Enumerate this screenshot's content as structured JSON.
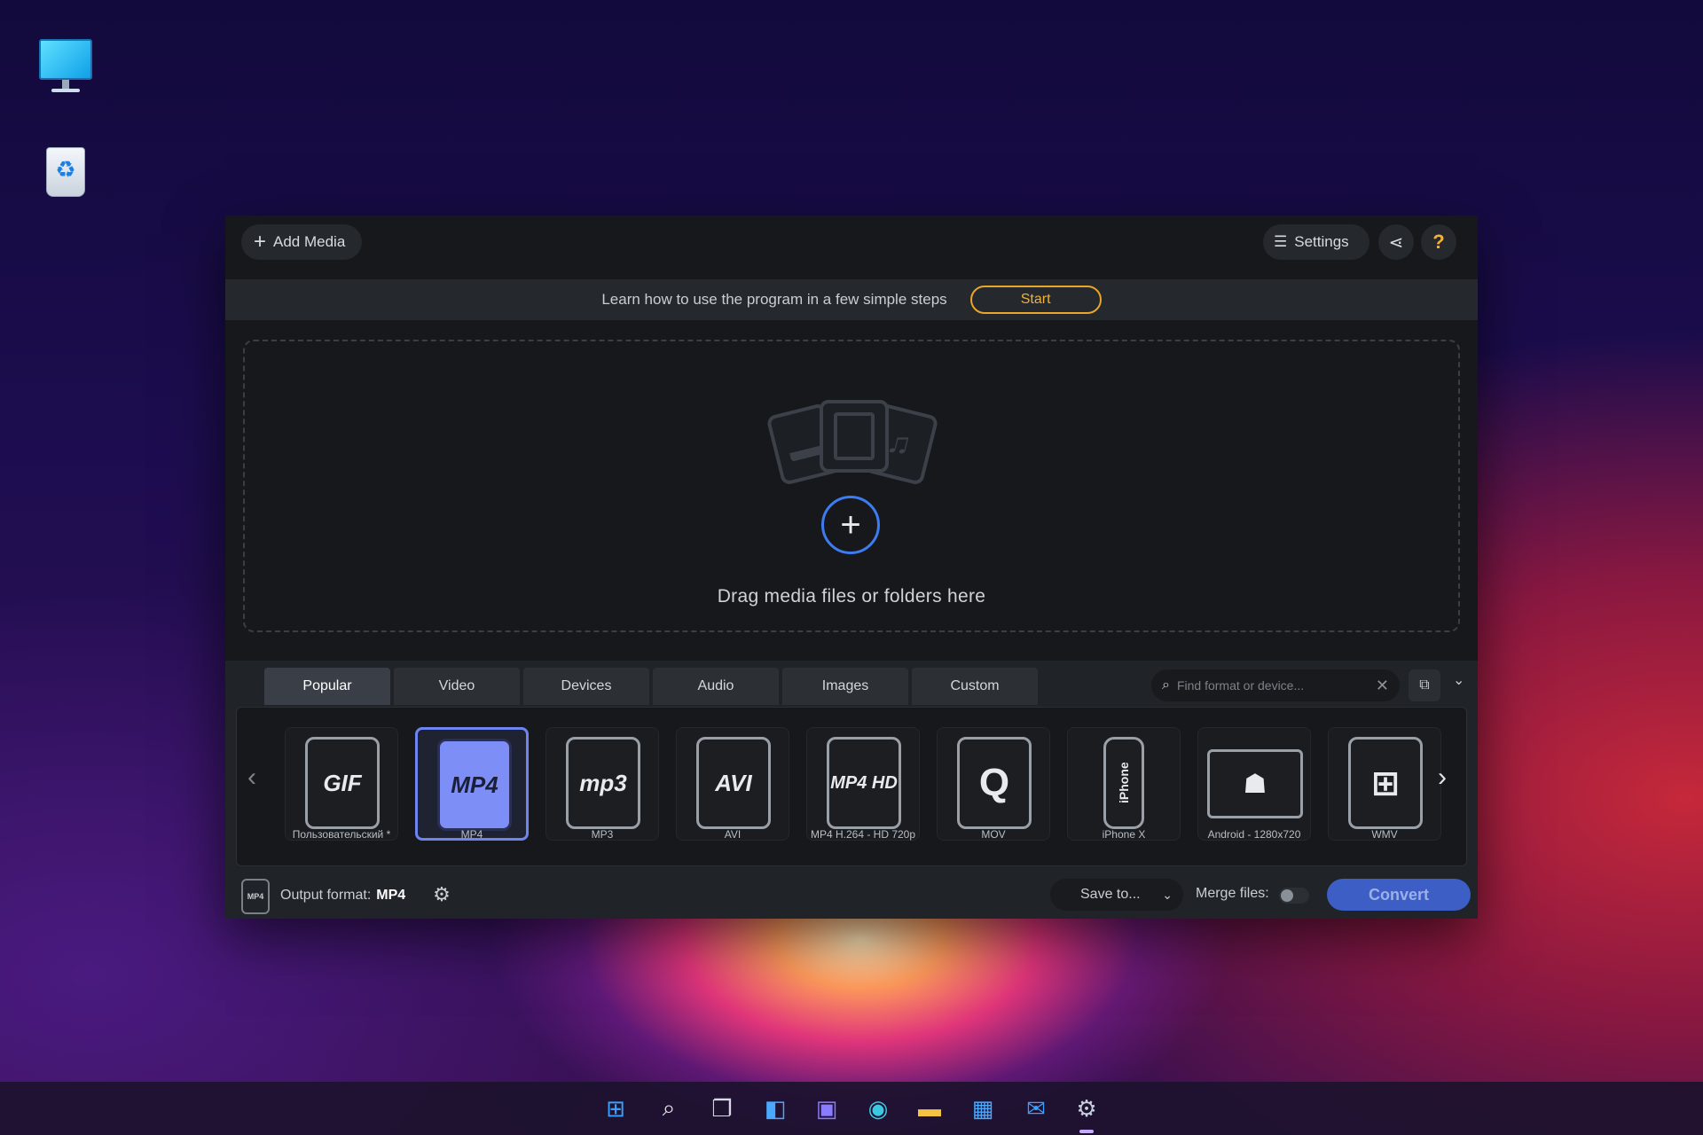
{
  "toolbar": {
    "add_media_label": "Add Media",
    "settings_label": "Settings",
    "help_label": "?"
  },
  "learn": {
    "text": "Learn how to use the program in a few simple steps",
    "start_label": "Start"
  },
  "dropzone": {
    "text": "Drag media files or folders here"
  },
  "tabs": [
    {
      "label": "Popular",
      "active": true
    },
    {
      "label": "Video",
      "active": false
    },
    {
      "label": "Devices",
      "active": false
    },
    {
      "label": "Audio",
      "active": false
    },
    {
      "label": "Images",
      "active": false
    },
    {
      "label": "Custom",
      "active": false
    }
  ],
  "search": {
    "placeholder": "Find format or device..."
  },
  "formats": [
    {
      "label": "Пользовательский *",
      "icon": "GIF",
      "selected": false
    },
    {
      "label": "MP4",
      "icon": "MP4",
      "selected": true
    },
    {
      "label": "MP3",
      "icon": "mp3",
      "selected": false
    },
    {
      "label": "AVI",
      "icon": "AVI",
      "selected": false
    },
    {
      "label": "MP4 H.264 - HD 720p",
      "icon": "MP4 HD",
      "selected": false
    },
    {
      "label": "MOV",
      "icon": "Q",
      "selected": false
    },
    {
      "label": "iPhone X",
      "icon": "iPhone",
      "selected": false
    },
    {
      "label": "Android - 1280x720",
      "icon": "android",
      "selected": false
    },
    {
      "label": "WMV",
      "icon": "windows",
      "selected": false
    }
  ],
  "bottom": {
    "mini_icon_text": "MP4",
    "output_label": "Output format:",
    "output_value": "MP4",
    "save_label": "Save to...",
    "merge_label": "Merge files:",
    "merge_on": false,
    "convert_label": "Convert"
  },
  "colors": {
    "accent_blue": "#3d5ec4",
    "start_orange": "#e9a628",
    "selected_format": "#7d8ff6"
  }
}
